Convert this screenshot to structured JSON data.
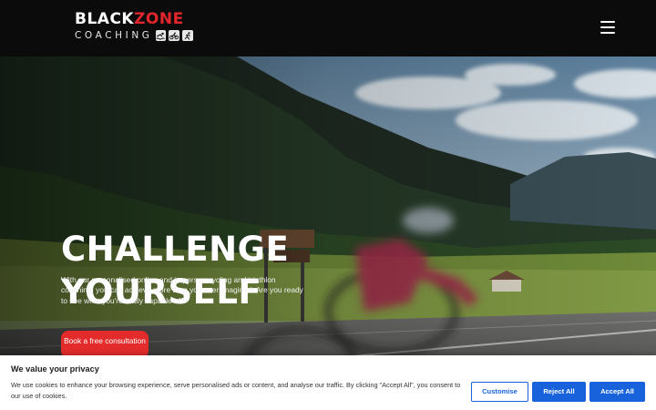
{
  "header": {
    "logo": {
      "black": "BLACK",
      "zone": "ZONE",
      "sub": "COACHING"
    },
    "menu_label": "Menu"
  },
  "hero": {
    "title_line1": "CHALLENGE",
    "title_line2": "YOURSELF",
    "text": "With our personalised online and in-person cycling and triathlon coaching, you can achieve more than you ever imagined. Are you ready to see what you're really capable of?",
    "cta": "Book a free consultation"
  },
  "cookie": {
    "title": "We value your privacy",
    "text": "We use cookies to enhance your browsing experience, serve personalised ads or content, and analyse our traffic. By clicking \"Accept All\", you consent to our use of cookies.",
    "customise": "Customise",
    "reject": "Reject All",
    "accept": "Accept All"
  },
  "colors": {
    "brand_red": "#e3262d",
    "cookie_blue": "#1863dc",
    "header_bg": "#0b0b0b"
  },
  "icons": [
    "swim-icon",
    "bike-icon",
    "run-icon",
    "menu-icon"
  ]
}
